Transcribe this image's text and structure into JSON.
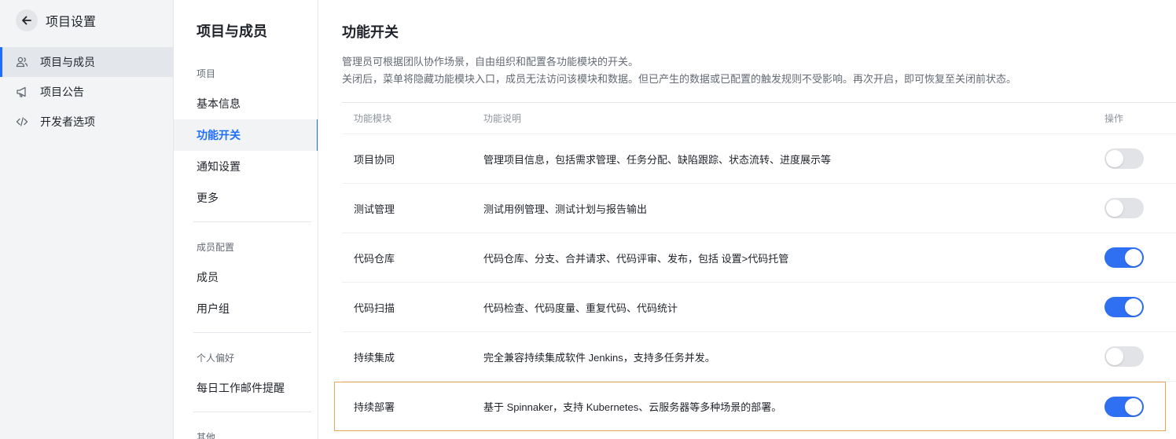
{
  "sidebar": {
    "title": "项目设置",
    "items": [
      {
        "label": "项目与成员",
        "icon": "members-icon",
        "active": true
      },
      {
        "label": "项目公告",
        "icon": "megaphone-icon",
        "active": false
      },
      {
        "label": "开发者选项",
        "icon": "code-icon",
        "active": false
      }
    ]
  },
  "subnav": {
    "title": "项目与成员",
    "groups": {
      "project": "项目",
      "members_config": "成员配置",
      "preferences": "个人偏好",
      "other": "其他"
    },
    "items": {
      "basic_info": "基本信息",
      "feature_switch": "功能开关",
      "notification": "通知设置",
      "more": "更多",
      "members": "成员",
      "user_groups": "用户组",
      "daily_email": "每日工作邮件提醒"
    }
  },
  "main": {
    "title": "功能开关",
    "desc_line1": "管理员可根据团队协作场景，自由组织和配置各功能模块的开关。",
    "desc_line2": "关闭后，菜单将隐藏功能模块入口，成员无法访问该模块和数据。但已产生的数据或已配置的触发规则不受影响。再次开启，即可恢复至关闭前状态。",
    "table": {
      "headers": {
        "module": "功能模块",
        "description": "功能说明",
        "action": "操作"
      },
      "rows": [
        {
          "module": "项目协同",
          "description": "管理项目信息，包括需求管理、任务分配、缺陷跟踪、状态流转、进度展示等",
          "enabled": false
        },
        {
          "module": "测试管理",
          "description": "测试用例管理、测试计划与报告输出",
          "enabled": false
        },
        {
          "module": "代码仓库",
          "description": "代码仓库、分支、合并请求、代码评审、发布，包括 设置>代码托管",
          "enabled": true
        },
        {
          "module": "代码扫描",
          "description": "代码检查、代码度量、重复代码、代码统计",
          "enabled": true
        },
        {
          "module": "持续集成",
          "description": "完全兼容持续集成软件 Jenkins，支持多任务并发。",
          "enabled": false
        },
        {
          "module": "持续部署",
          "description": "基于 Spinnaker，支持 Kubernetes、云服务器等多种场景的部署。",
          "enabled": true
        }
      ]
    }
  },
  "colors": {
    "accent": "#1e6fff",
    "toggle_on": "#2f6ff2",
    "toggle_off": "#e1e3e6",
    "highlight_border": "#e8a55a"
  }
}
